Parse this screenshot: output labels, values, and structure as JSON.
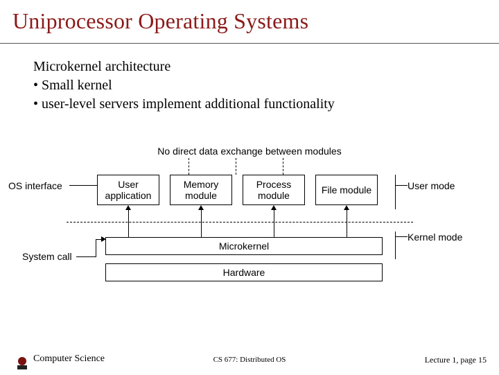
{
  "title": "Uniprocessor Operating Systems",
  "body": {
    "heading": "Microkernel architecture",
    "b1": "• Small kernel",
    "b2": "• user-level servers implement additional functionality"
  },
  "diagram": {
    "caption": "No direct data exchange between modules",
    "left_label_top": "OS interface",
    "left_label_bottom": "System call",
    "right_label_top": "User mode",
    "right_label_bottom": "Kernel mode",
    "boxes": {
      "user_app_1": "User",
      "user_app_2": "application",
      "memory_1": "Memory",
      "memory_2": "module",
      "process_1": "Process",
      "process_2": "module",
      "file": "File module"
    },
    "microkernel": "Microkernel",
    "hardware": "Hardware"
  },
  "footer": {
    "left": "Computer Science",
    "center": "CS 677: Distributed OS",
    "right": "Lecture 1, page 15"
  }
}
